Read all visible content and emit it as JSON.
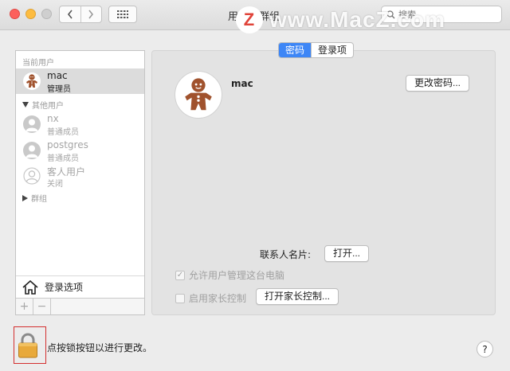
{
  "window": {
    "title": "用户与群组",
    "search_placeholder": "搜索",
    "watermark_logo": "Z",
    "watermark_text": "www.MacZ.com"
  },
  "sidebar": {
    "current_users_label": "当前用户",
    "current_user": {
      "name": "mac",
      "role": "管理员"
    },
    "other_users_label": "其他用户",
    "other_users": [
      {
        "name": "nx",
        "role": "普通成员"
      },
      {
        "name": "postgres",
        "role": "普通成员"
      },
      {
        "name": "客人用户",
        "role": "关闭"
      }
    ],
    "groups_label": "群组",
    "login_options_label": "登录选项",
    "add_label": "+",
    "remove_label": "−"
  },
  "tabs": [
    {
      "label": "密码",
      "active": true
    },
    {
      "label": "登录项",
      "active": false
    }
  ],
  "main": {
    "user_name": "mac",
    "change_password_label": "更改密码...",
    "contact_card_label": "联系人名片:",
    "open_label": "打开...",
    "allow_admin_label": "允许用户管理这台电脑",
    "allow_admin_checked": true,
    "parental_label": "启用家长控制",
    "parental_checked": false,
    "open_parental_label": "打开家长控制..."
  },
  "footer": {
    "lock_text": "点按锁按钮以进行更改。",
    "help_label": "?"
  },
  "colors": {
    "accent": "#3d86f6",
    "lock_highlight": "#d32f2f"
  }
}
